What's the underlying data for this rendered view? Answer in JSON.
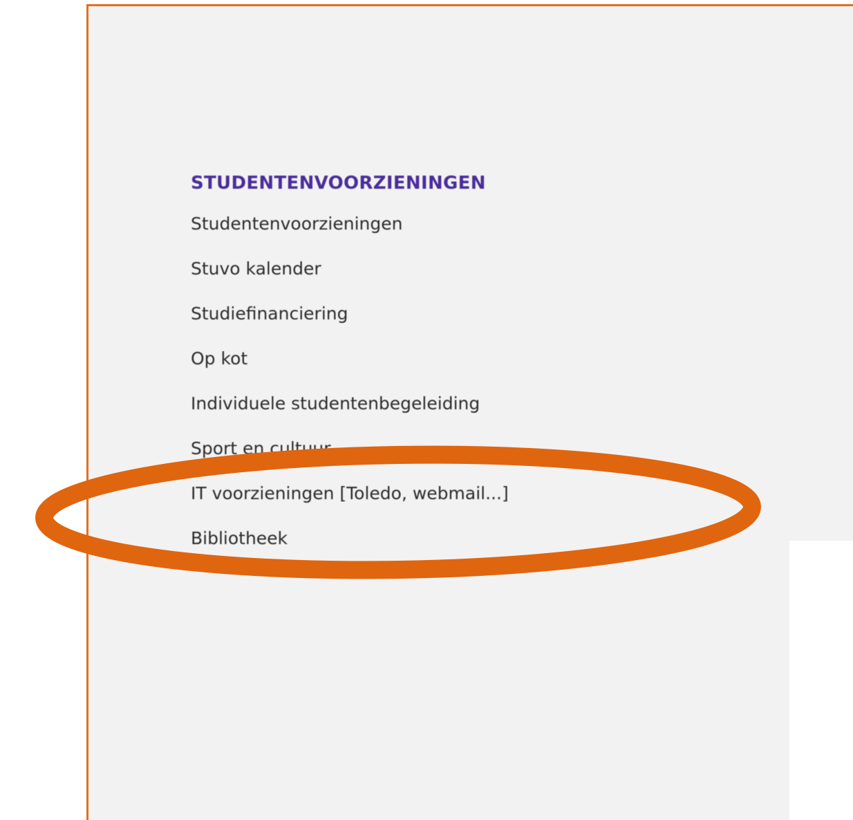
{
  "menu": {
    "title": "STUDENTENVOORZIENINGEN",
    "items": [
      {
        "label": "Studentenvoorzieningen"
      },
      {
        "label": "Stuvo kalender"
      },
      {
        "label": "Studiefinanciering"
      },
      {
        "label": "Op kot"
      },
      {
        "label": "Individuele studentenbegeleiding"
      },
      {
        "label": "Sport en cultuur"
      },
      {
        "label": "IT voorzieningen [Toledo, webmail...]"
      },
      {
        "label": "Bibliotheek"
      }
    ]
  },
  "colors": {
    "frame_border": "#e07020",
    "highlight": "#e0650f",
    "title": "#4a2d9a",
    "panel_background": "#f2f2f2"
  }
}
